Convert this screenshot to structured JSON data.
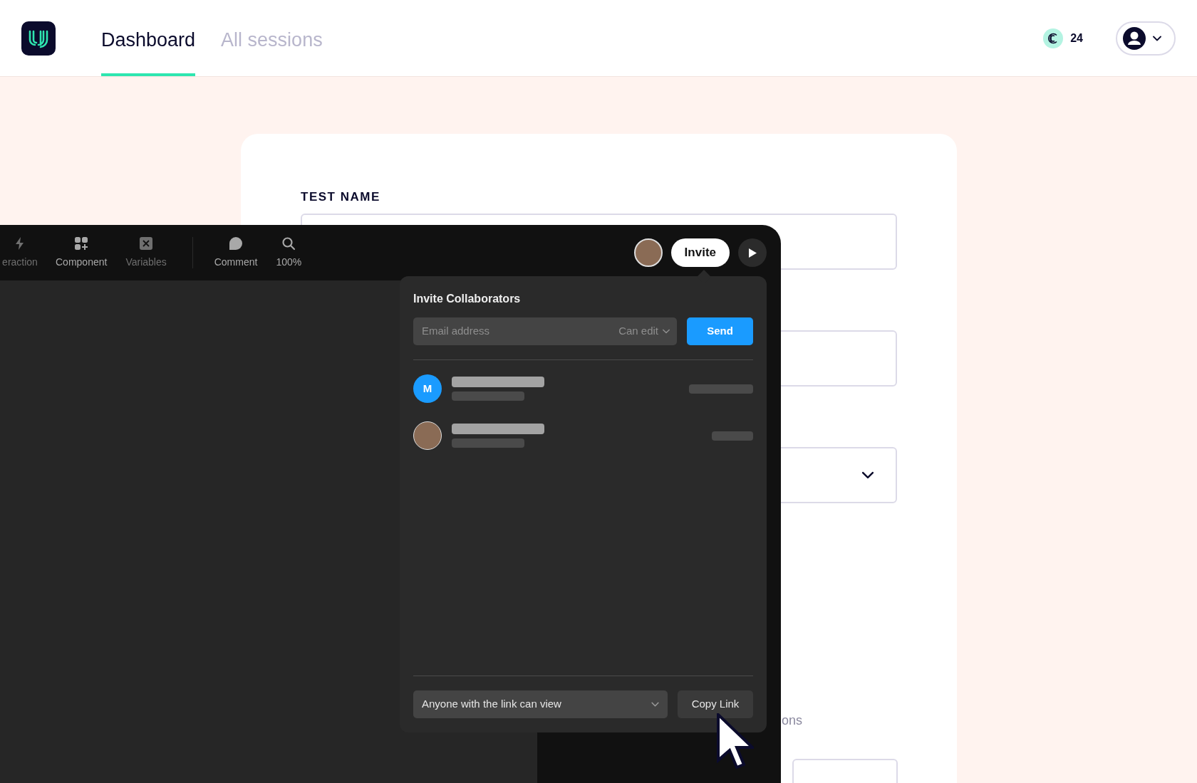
{
  "header": {
    "tabs": [
      {
        "label": "Dashboard",
        "selected": true
      },
      {
        "label": "All sessions",
        "selected": false
      }
    ],
    "credits": "24"
  },
  "form": {
    "field_label": "TEST NAME",
    "partial_text": "ons"
  },
  "editor": {
    "toolbar": [
      {
        "label": "eraction",
        "kind": "bolt",
        "disabled": true
      },
      {
        "label": "Component",
        "kind": "component",
        "disabled": false
      },
      {
        "label": "Variables",
        "kind": "variables",
        "disabled": true
      },
      {
        "label": "Comment",
        "kind": "comment",
        "disabled": false
      },
      {
        "label": "100%",
        "kind": "zoom",
        "disabled": false
      }
    ],
    "invite_button": "Invite",
    "panel": {
      "title": "Invite Collaborators",
      "email_placeholder": "Email address",
      "permission": "Can edit",
      "send": "Send",
      "members": [
        {
          "kind": "initial",
          "initial": "M"
        },
        {
          "kind": "photo"
        }
      ],
      "link_access": "Anyone with the link can view",
      "copy_link": "Copy Link"
    }
  }
}
